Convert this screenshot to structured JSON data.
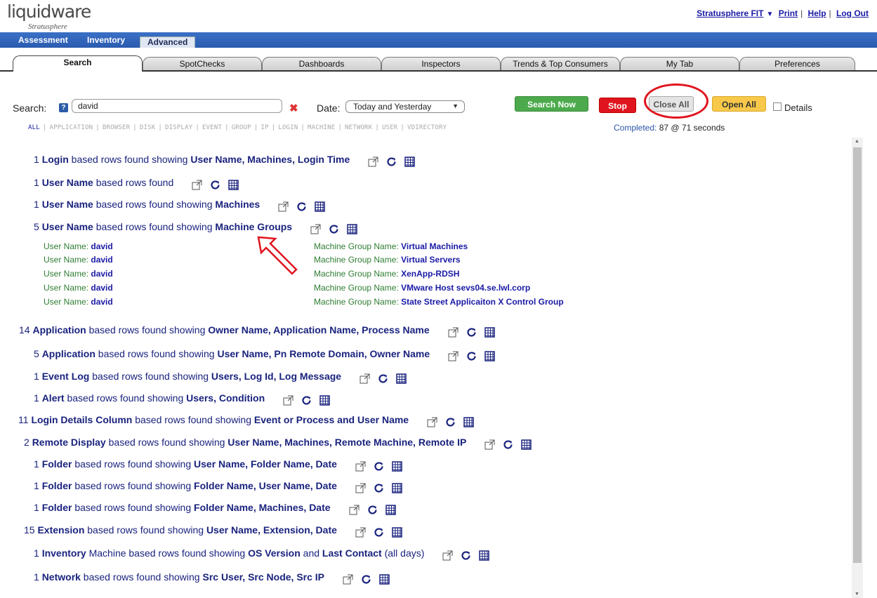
{
  "logo": {
    "brand": "liquidware",
    "product": "Stratusphere"
  },
  "top_links": {
    "fit": "Stratusphere FIT",
    "print": "Print",
    "help": "Help",
    "logout": "Log Out"
  },
  "main_tabs": [
    "Assessment",
    "Inventory",
    "Advanced"
  ],
  "sub_tabs": [
    "Search",
    "SpotChecks",
    "Dashboards",
    "Inspectors",
    "Trends & Top Consumers",
    "My Tab",
    "Preferences"
  ],
  "search": {
    "label": "Search:",
    "help": "?",
    "value": "david",
    "date_label": "Date:",
    "date_value": "Today and Yesterday",
    "search_now": "Search Now",
    "stop": "Stop",
    "close_all": "Close All",
    "open_all": "Open All",
    "details": "Details"
  },
  "filters": [
    "ALL",
    "APPLICATION",
    "BROWSER",
    "DISK",
    "DISPLAY",
    "EVENT",
    "GROUP",
    "IP",
    "LOGIN",
    "MACHINE",
    "NETWORK",
    "USER",
    "VDIRECTORY"
  ],
  "status": {
    "label": "Completed:",
    "value": "87 @ 71 seconds"
  },
  "results": [
    {
      "count": "1",
      "type": "Login",
      "mid": " based rows found showing ",
      "cols": "User Name, Machines, Login Time"
    },
    {
      "count": "1",
      "type": "User Name",
      "mid": " based rows found",
      "cols": ""
    },
    {
      "count": "1",
      "type": "User Name",
      "mid": " based rows found showing ",
      "cols": "Machines"
    },
    {
      "count": "5",
      "type": "User Name",
      "mid": " based rows found showing ",
      "cols": "Machine Groups"
    },
    {
      "count": "14",
      "type": "Application",
      "mid": " based rows found showing ",
      "cols": "Owner Name, Application Name, Process Name"
    },
    {
      "count": "5",
      "type": "Application",
      "mid": " based rows found showing ",
      "cols": "User Name, Pn Remote Domain, Owner Name"
    },
    {
      "count": "1",
      "type": "Event Log",
      "mid": " based rows found showing ",
      "cols": "Users, Log Id, Log Message"
    },
    {
      "count": "1",
      "type": "Alert",
      "mid": " based rows found showing ",
      "cols": "Users, Condition"
    },
    {
      "count": "11",
      "type": "Login Details Column",
      "mid": " based rows found showing ",
      "cols": "Event or Process and User Name"
    },
    {
      "count": "2",
      "type": "Remote Display",
      "mid": " based rows found showing ",
      "cols": "User Name, Machines, Remote Machine, Remote IP"
    },
    {
      "count": "1",
      "type": "Folder",
      "mid": " based rows found showing ",
      "cols": "User Name, Folder Name, Date"
    },
    {
      "count": "1",
      "type": "Folder",
      "mid": " based rows found showing ",
      "cols": "Folder Name, User Name, Date"
    },
    {
      "count": "1",
      "type": "Folder",
      "mid": " based rows found showing ",
      "cols": "Folder Name, Machines, Date"
    },
    {
      "count": "15",
      "type": "Extension",
      "mid": " based rows found showing ",
      "cols": "User Name, Extension, Date"
    },
    {
      "count": "1",
      "type": "Network",
      "mid": " based rows found showing ",
      "cols": "Src User, Src Node, Src IP"
    }
  ],
  "inventory_row": {
    "count": "1",
    "type": "Inventory",
    "mid1": " Machine based rows found showing ",
    "b1": "OS Version",
    "mid2": " and ",
    "b2": "Last Contact",
    "tail": " (all days)"
  },
  "details": {
    "user_key": "User Name:",
    "group_key": "Machine Group Name:",
    "rows": [
      {
        "user": "david",
        "group": "Virtual Machines"
      },
      {
        "user": "david",
        "group": "Virtual Servers"
      },
      {
        "user": "david",
        "group": "XenApp-RDSH"
      },
      {
        "user": "david",
        "group": "VMware Host sevs04.se.lwl.corp"
      },
      {
        "user": "david",
        "group": "State Street Applicaiton X Control Group"
      }
    ]
  },
  "colors": {
    "link": "#1a237e",
    "key": "#2e7d32",
    "annotation": "#e0141e",
    "tabbar": "#2a5bb0"
  }
}
